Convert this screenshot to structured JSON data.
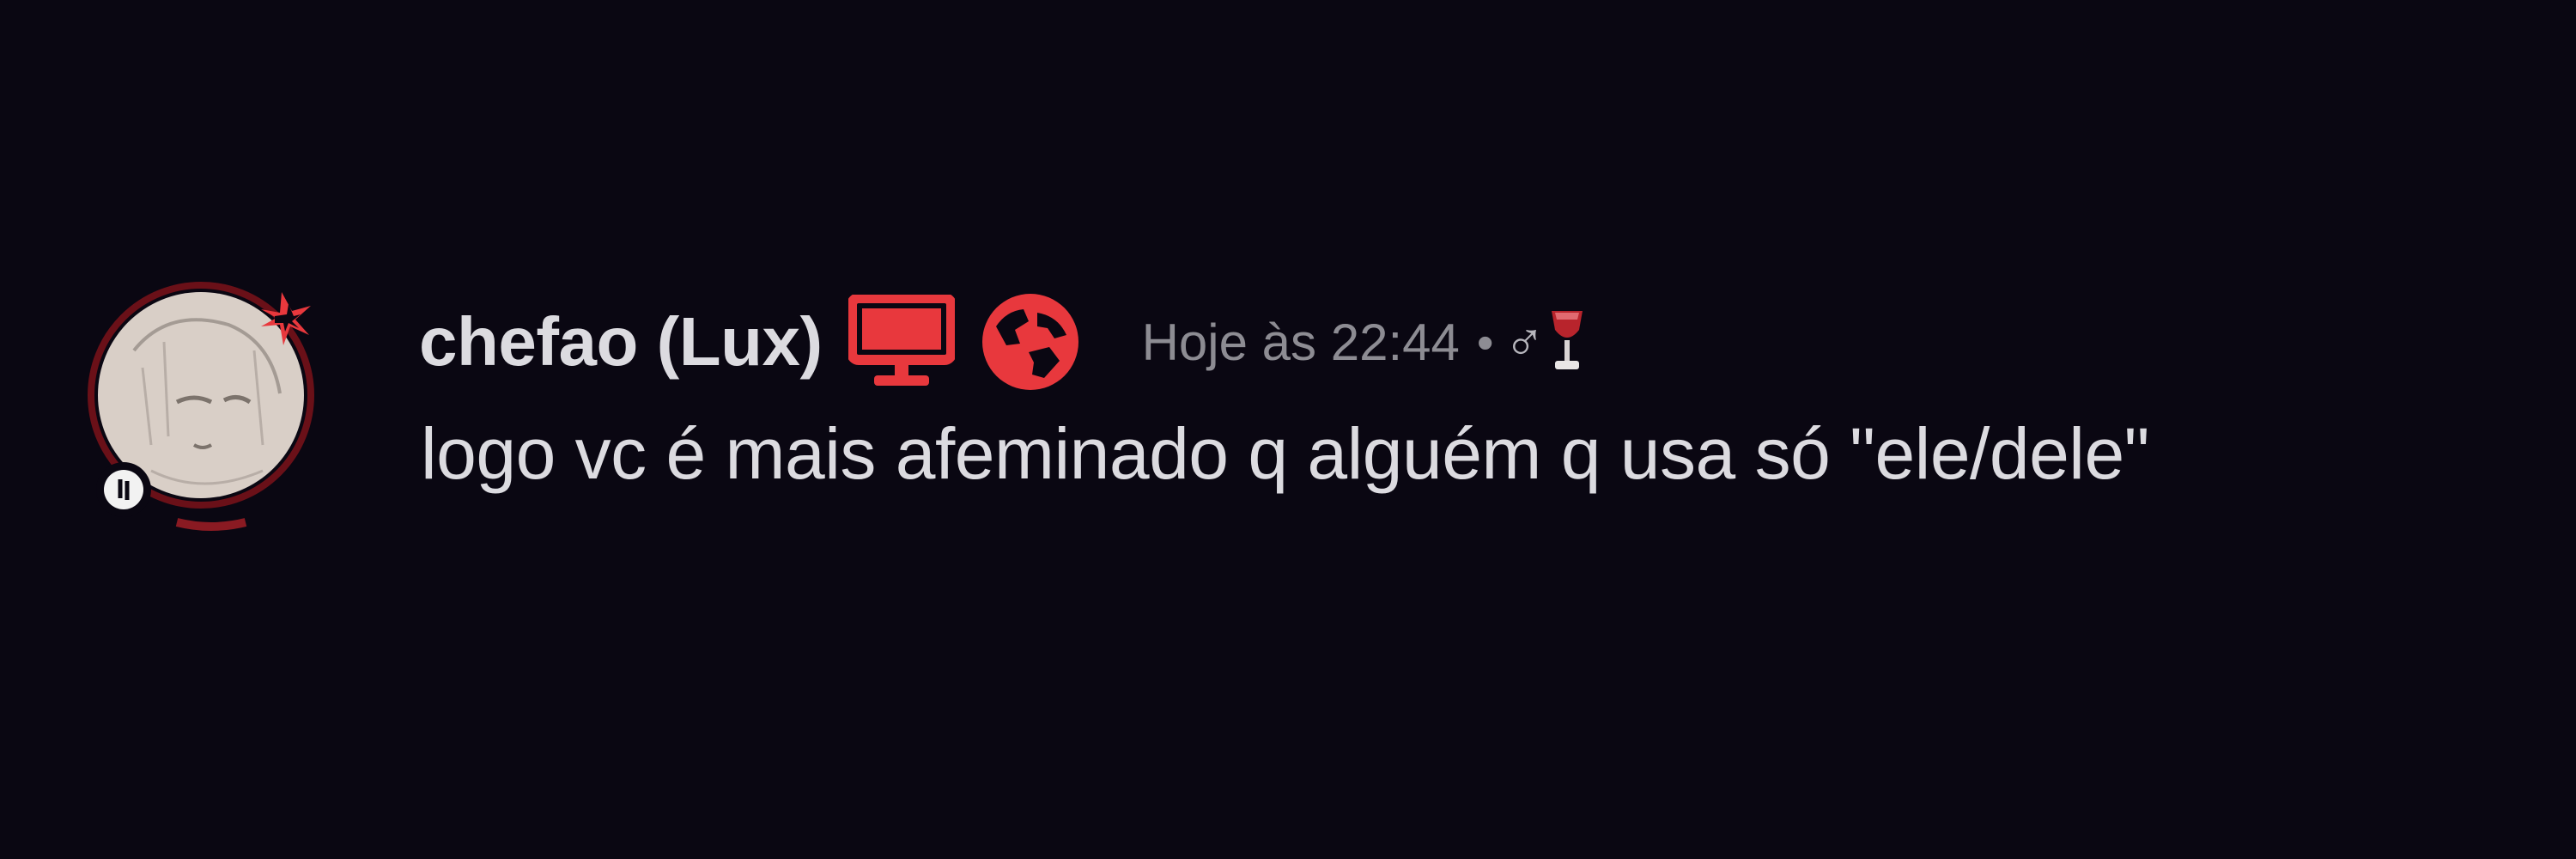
{
  "message": {
    "author": {
      "display_name": "chefao (Lux)",
      "avatar_icon": "anime-avatar-icon",
      "status_icon": "status-idle-icon",
      "badges": [
        {
          "name": "desktop-icon",
          "color": "#e8383d"
        },
        {
          "name": "globe-icon",
          "color": "#e8383d"
        }
      ]
    },
    "timestamp": "Hoje às 22:44",
    "separator": "•",
    "pronoun_symbol": "♂",
    "emoji_icon": "wine-glass-icon",
    "content": "logo vc é mais afeminado q alguém q usa só \"ele/dele\""
  },
  "colors": {
    "background": "#0a0712",
    "accent": "#e8383d",
    "text": "#dcdbe0",
    "muted": "#8d8c93"
  }
}
